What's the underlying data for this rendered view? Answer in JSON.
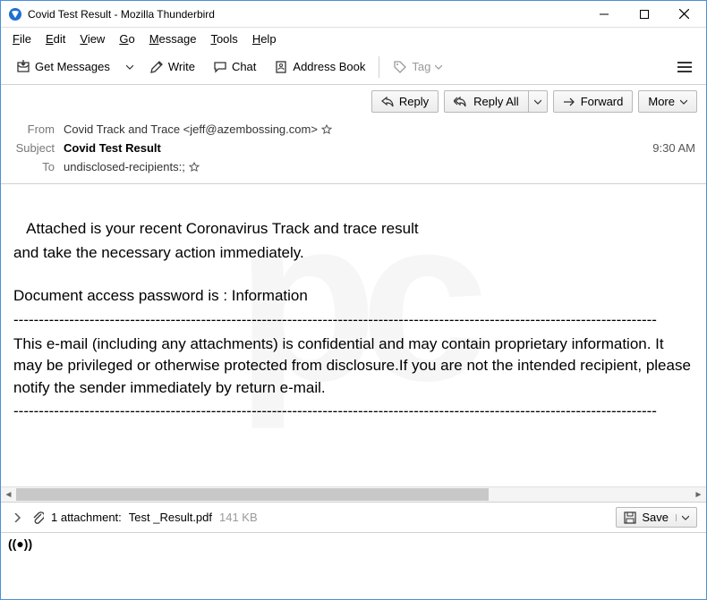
{
  "window": {
    "title": "Covid Test Result - Mozilla Thunderbird"
  },
  "menubar": {
    "file": "File",
    "edit": "Edit",
    "view": "View",
    "go": "Go",
    "message": "Message",
    "tools": "Tools",
    "help": "Help"
  },
  "toolbar": {
    "get_messages": "Get Messages",
    "write": "Write",
    "chat": "Chat",
    "address_book": "Address Book",
    "tag": "Tag"
  },
  "msg_actions": {
    "reply": "Reply",
    "reply_all": "Reply All",
    "forward": "Forward",
    "more": "More"
  },
  "headers": {
    "from_label": "From",
    "from_value": "Covid Track and Trace <jeff@azembossing.com>",
    "subject_label": "Subject",
    "subject_value": "Covid Test Result",
    "time": "9:30 AM",
    "to_label": "To",
    "to_value": "undisclosed-recipients:;"
  },
  "body": {
    "line1": "   Attached is your recent Coronavirus Track and trace result",
    "line2": "and take the necessary action immediately.",
    "line3": "Document access password is : Information",
    "dashes": "-------------------------------------------------------------------------------------------------------------------------------",
    "disclaimer": "This e-mail (including any attachments) is confidential and may contain proprietary information. It may be privileged or otherwise protected from disclosure.If you are not the intended recipient, please notify the sender immediately by return e-mail."
  },
  "attachment": {
    "count_text": "1 attachment:",
    "filename": "Test _Result.pdf",
    "size": "141 KB",
    "save": "Save"
  }
}
